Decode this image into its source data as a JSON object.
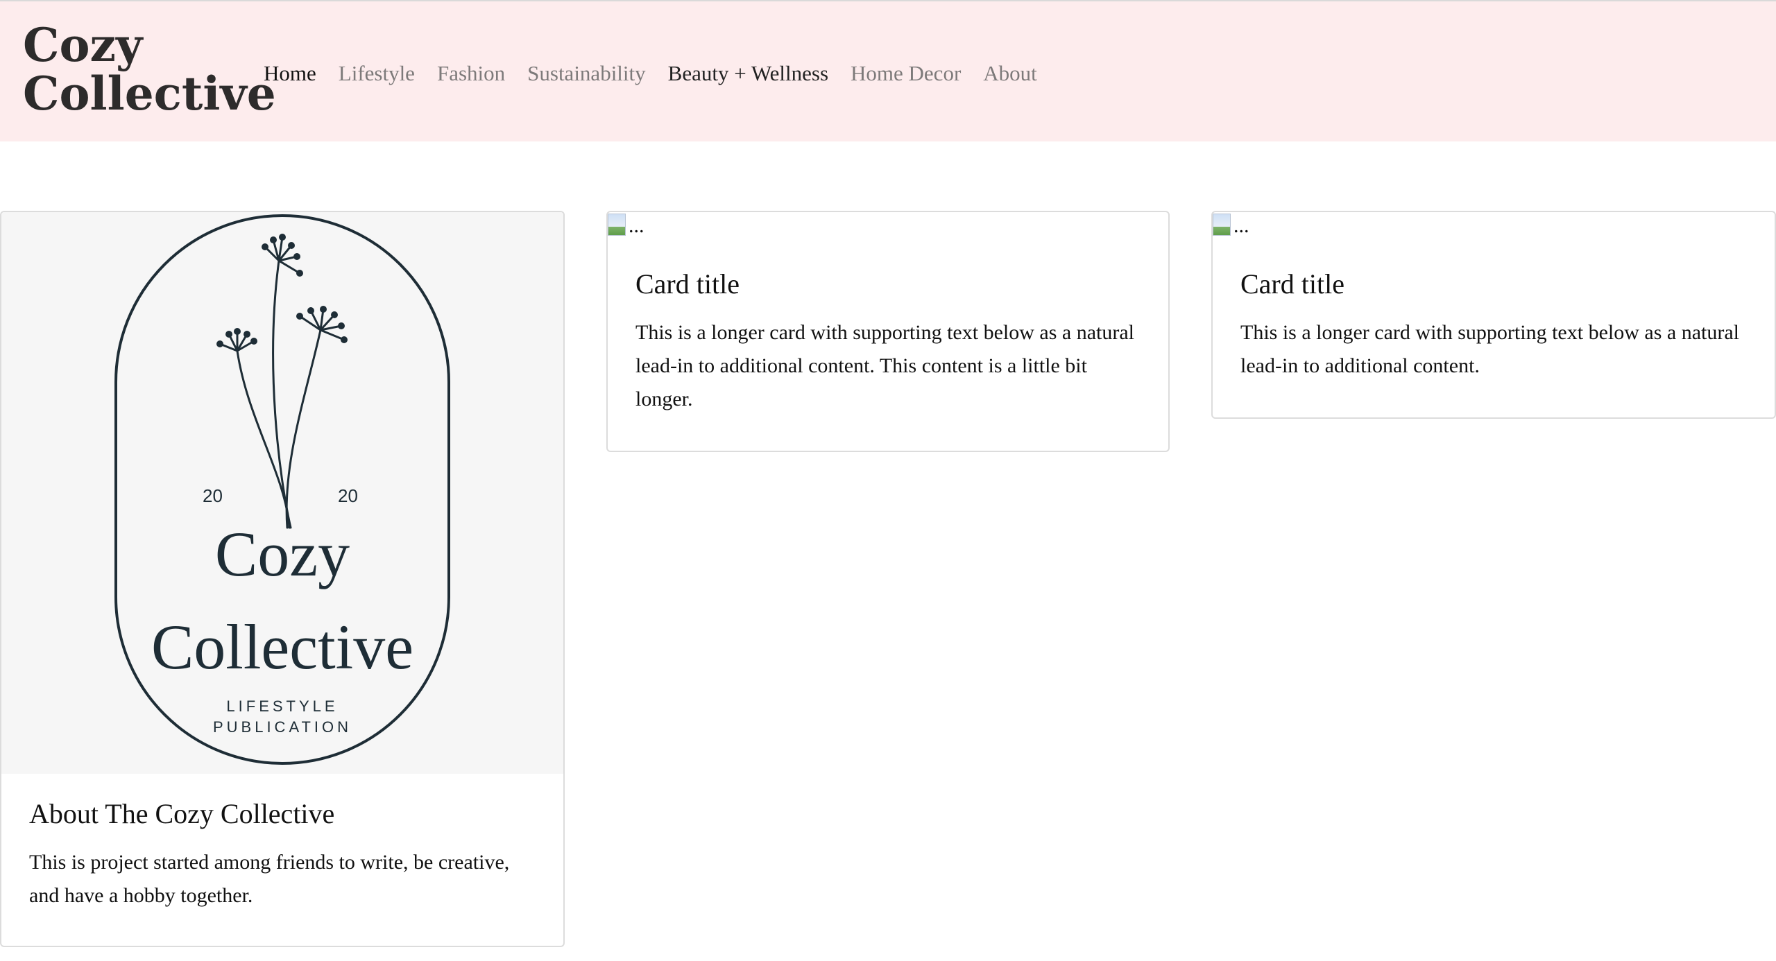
{
  "navbar": {
    "brand_line1": "Cozy",
    "brand_line2": "Collective",
    "items": [
      {
        "label": "Home"
      },
      {
        "label": "Lifestyle"
      },
      {
        "label": "Fashion"
      },
      {
        "label": "Sustainability"
      },
      {
        "label": "Beauty + Wellness"
      },
      {
        "label": "Home Decor"
      },
      {
        "label": "About"
      }
    ]
  },
  "cards": [
    {
      "image_alt": "Cozy Collective 2020 Lifestyle Publication logo",
      "logo": {
        "year_left": "20",
        "year_right": "20",
        "name_line1": "Cozy",
        "name_line2": "Collective",
        "sub_line1": "LIFESTYLE",
        "sub_line2": "PUBLICATION"
      },
      "title": "About The Cozy Collective",
      "text": "This is project started among friends to write, be creative, and have a hobby together."
    },
    {
      "image_alt": "...",
      "title": "Card title",
      "text": "This is a longer card with supporting text below as a natural lead-in to additional content. This content is a little bit longer."
    },
    {
      "image_alt": "...",
      "title": "Card title",
      "text": "This is a longer card with supporting text below as a natural lead-in to additional content."
    }
  ],
  "colors": {
    "navbar_bg": "#fdeced",
    "logo_ink": "#1e2d36",
    "nav_muted": "#7d7a7a"
  }
}
